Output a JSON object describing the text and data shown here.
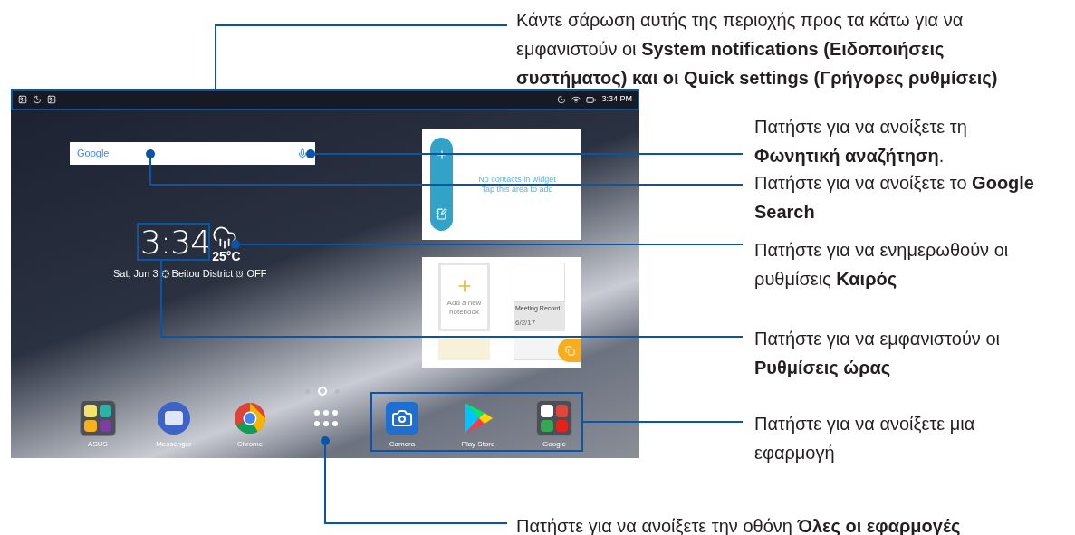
{
  "status_bar": {
    "time": "3:34 PM"
  },
  "search_bar": {
    "logo": "Google"
  },
  "clock_widget": {
    "time": "3:34",
    "temperature": "25°C",
    "date": "Sat, Jun 3",
    "location": "Beitou District",
    "alarm": "OFF"
  },
  "contacts_widget": {
    "message": [
      "No contacts in widget",
      "Tap this area to add"
    ]
  },
  "notebook_widget": {
    "new_notebook": "Add a new notebook",
    "notebook": {
      "title": "Meeting Record",
      "date": "6/2/17"
    }
  },
  "page_indicator": [
    {
      "selected": false
    },
    {
      "selected": true
    },
    {
      "selected": false
    }
  ],
  "dock": [
    {
      "kind": "folder",
      "label": "ASUS"
    },
    {
      "kind": "messenger",
      "label": "Messenger"
    },
    {
      "kind": "browser",
      "label": "Chrome"
    },
    {
      "kind": "apps"
    },
    {
      "kind": "camera",
      "label": "Camera"
    },
    {
      "kind": "store",
      "label": "Play Store"
    },
    {
      "kind": "folder",
      "label": "Google"
    }
  ],
  "callouts": [
    {
      "text": "Κάντε σάρωση αυτής της περιοχής προς τα κάτω για να εμφανιστούν οι **System notifications (Ειδοποιήσεις συστήματος) και οι Quick settings (Γρήγορες ρυθμίσεις)**"
    },
    {
      "text": "Πατήστε για να ανοίξετε τη **Φωνητική αναζήτηση**."
    },
    {
      "text": "Πατήστε για να ανοίξετε το **Google Search**"
    },
    {
      "text": "Πατήστε για να ενημερωθούν οι ρυθμίσεις **Καιρός**"
    },
    {
      "text": "Πατήστε για να εμφανιστούν οι **Ρυθμίσεις ώρας**"
    },
    {
      "text": "Πατήστε για να ανοίξετε μια εφαρμογή"
    },
    {
      "text": "Πατήστε για να ανοίξετε την οθόνη **Όλες οι εφαρμογές**"
    }
  ]
}
